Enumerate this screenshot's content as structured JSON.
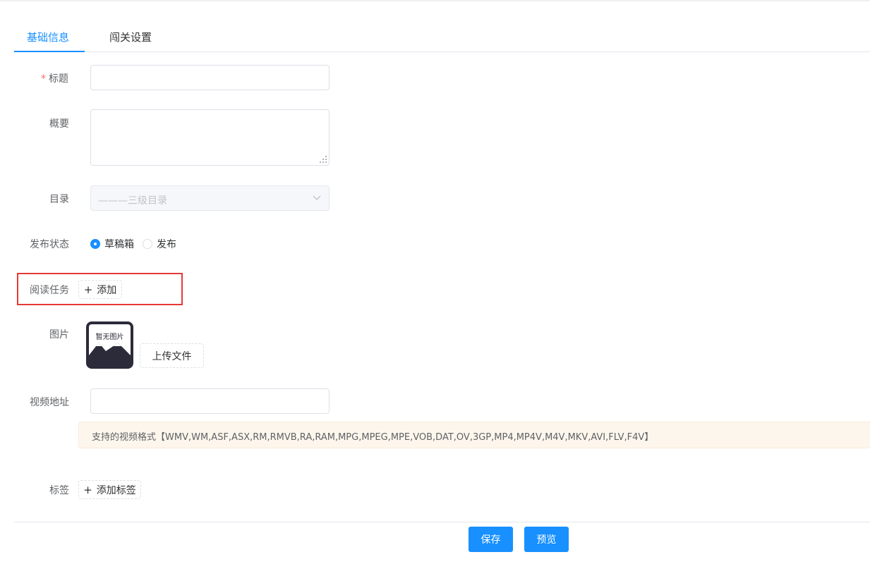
{
  "tabs": [
    {
      "label": "基础信息",
      "active": true
    },
    {
      "label": "闯关设置",
      "active": false
    }
  ],
  "form": {
    "title": {
      "required_mark": "*",
      "label": "标题",
      "value": ""
    },
    "summary": {
      "label": "概要",
      "value": ""
    },
    "catalog": {
      "label": "目录",
      "placeholder": "———三级目录",
      "disabled": true
    },
    "publish_status": {
      "label": "发布状态",
      "options": [
        {
          "label": "草稿箱",
          "checked": true
        },
        {
          "label": "发布",
          "checked": false
        }
      ]
    },
    "reading_task": {
      "label": "阅读任务",
      "add_label": "添加",
      "highlighted": true
    },
    "image": {
      "label": "图片",
      "placeholder_text": "暂无图片",
      "upload_label": "上传文件"
    },
    "video_url": {
      "label": "视频地址",
      "value": ""
    },
    "video_formats_tip": "支持的视频格式【WMV,WM,ASF,ASX,RM,RMVB,RA,RAM,MPG,MPEG,MPE,VOB,DAT,OV,3GP,MP4,MP4V,M4V,MKV,AVI,FLV,F4V】",
    "tags": {
      "label": "标签",
      "add_label": "添加标签"
    }
  },
  "actions": {
    "save_label": "保存",
    "preview_label": "预览"
  },
  "colors": {
    "primary": "#1890ff",
    "highlight_border": "#e53935",
    "warning_bg": "#fdf6ec"
  }
}
